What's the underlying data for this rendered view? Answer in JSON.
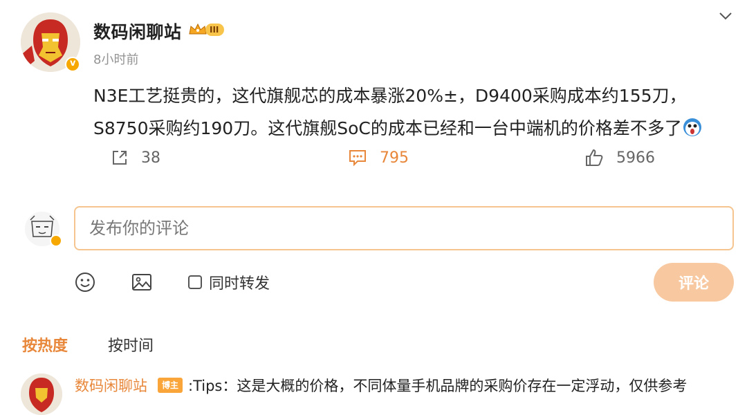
{
  "post": {
    "author": {
      "name": "数码闲聊站",
      "rank_label": "III",
      "avatar_icon": "ironman-avatar-icon",
      "verified_icon": "verified-badge-icon"
    },
    "time": "8小时前",
    "content_line1": "N3E工艺挺贵的，这代旗舰芯的成本暴涨20%±，D9400采购成本约155刀，",
    "content_line2": "S8750采购约190刀。这代旗舰SoC的成本已经和一台中端机的价格差不多了",
    "content_emoji": "shocked-face-emoji",
    "stats": {
      "shares": "38",
      "comments": "795",
      "likes": "5966"
    }
  },
  "composer": {
    "placeholder": "发布你的评论",
    "repost_label": "同时转发",
    "submit_label": "评论",
    "tools": [
      "emoji-icon",
      "image-icon"
    ]
  },
  "sort": {
    "hot_label": "按热度",
    "time_label": "按时间"
  },
  "comments": [
    {
      "user": "数码闲聊站",
      "badge": "博主",
      "text": ":Tips：这是大概的价格，不同体量手机品牌的采购价存在一定浮动，仅供参考"
    }
  ],
  "colors": {
    "accent": "#e8873a",
    "submit_bg": "#f8c9a1",
    "input_border": "#f5c48f",
    "muted_text": "#939393"
  }
}
